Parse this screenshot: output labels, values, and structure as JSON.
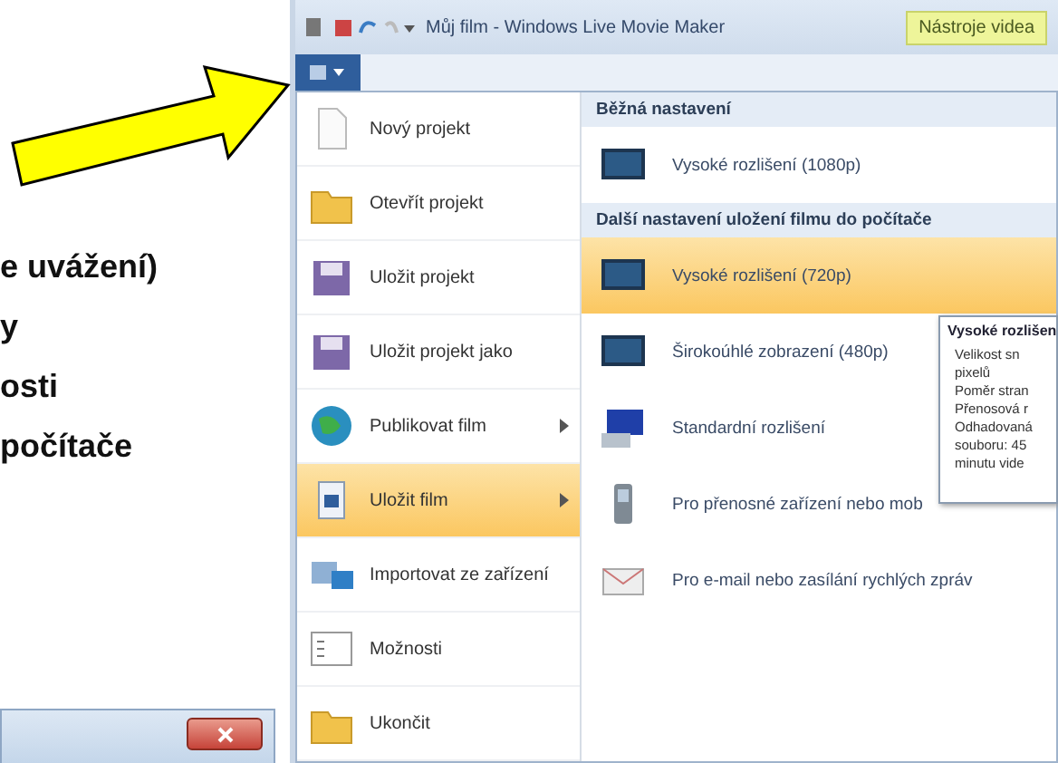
{
  "slide_text": [
    "e uvážení)",
    "y",
    "osti",
    "počítače"
  ],
  "window": {
    "title": "Můj film - Windows Live Movie Maker",
    "context_tab": "Nástroje videa"
  },
  "menu": {
    "items": [
      {
        "label": "Nový projekt",
        "kind": "page",
        "submenu": false,
        "selected": false
      },
      {
        "label": "Otevřít projekt",
        "kind": "folder",
        "submenu": false,
        "selected": false
      },
      {
        "label": "Uložit projekt",
        "kind": "disk",
        "submenu": false,
        "selected": false
      },
      {
        "label": "Uložit projekt jako",
        "kind": "disk",
        "submenu": false,
        "selected": false
      },
      {
        "label": "Publikovat film",
        "kind": "globe",
        "submenu": true,
        "selected": false
      },
      {
        "label": "Uložit film",
        "kind": "film",
        "submenu": true,
        "selected": true
      },
      {
        "label": "Importovat ze zařízení",
        "kind": "camera",
        "submenu": false,
        "selected": false
      },
      {
        "label": "Možnosti",
        "kind": "list",
        "submenu": false,
        "selected": false
      },
      {
        "label": "Ukončit",
        "kind": "folder",
        "submenu": false,
        "selected": false
      }
    ]
  },
  "submenu": {
    "sections": [
      {
        "heading": "Běžná nastavení",
        "items": [
          {
            "label": "Vysoké rozlišení (1080p)",
            "kind": "monitor",
            "selected": false
          }
        ]
      },
      {
        "heading": "Další nastavení uložení filmu do počítače",
        "items": [
          {
            "label": "Vysoké rozlišení (720p)",
            "kind": "monitor",
            "selected": true
          },
          {
            "label": "Širokoúhlé zobrazení (480p)",
            "kind": "monitor",
            "selected": false
          },
          {
            "label": "Standardní rozlišení",
            "kind": "computer",
            "selected": false
          },
          {
            "label": "Pro přenosné zařízení nebo mob",
            "kind": "phone",
            "selected": false
          },
          {
            "label": "Pro e-mail nebo zasílání rychlých zpráv",
            "kind": "mail",
            "selected": false
          }
        ]
      }
    ]
  },
  "tooltip": {
    "title": "Vysoké rozlišen",
    "lines": [
      "Velikost sn",
      "pixelů",
      "Poměr stran",
      "Přenosová r",
      "Odhadovaná",
      "souboru: 45",
      "minutu vide"
    ]
  }
}
